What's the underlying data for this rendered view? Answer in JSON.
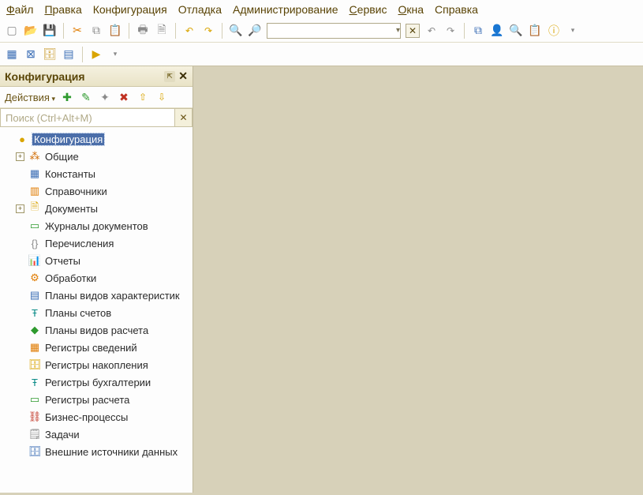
{
  "menu": {
    "file": "Файл",
    "edit": "Правка",
    "config": "Конфигурация",
    "debug": "Отладка",
    "admin": "Администрирование",
    "service": "Сервис",
    "windows": "Окна",
    "help": "Справка"
  },
  "toolbar": {
    "search_value": "",
    "search_clear": "✕",
    "dropdown_arrow": "▾"
  },
  "panel": {
    "title": "Конфигурация",
    "pin": "⇱",
    "close": "✕",
    "actions_label": "Действия",
    "search_placeholder": "Поиск (Ctrl+Alt+M)",
    "search_clear": "✕"
  },
  "tree": {
    "root": "Конфигурация",
    "items": [
      {
        "label": "Общие"
      },
      {
        "label": "Константы"
      },
      {
        "label": "Справочники"
      },
      {
        "label": "Документы"
      },
      {
        "label": "Журналы документов"
      },
      {
        "label": "Перечисления"
      },
      {
        "label": "Отчеты"
      },
      {
        "label": "Обработки"
      },
      {
        "label": "Планы видов характеристик"
      },
      {
        "label": "Планы счетов"
      },
      {
        "label": "Планы видов расчета"
      },
      {
        "label": "Регистры сведений"
      },
      {
        "label": "Регистры накопления"
      },
      {
        "label": "Регистры бухгалтерии"
      },
      {
        "label": "Регистры расчета"
      },
      {
        "label": "Бизнес-процессы"
      },
      {
        "label": "Задачи"
      },
      {
        "label": "Внешние источники данных"
      }
    ]
  }
}
